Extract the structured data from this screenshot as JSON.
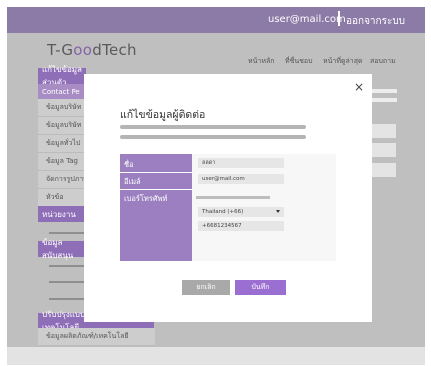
{
  "topbar": {
    "user_email": "user@mail.com",
    "logout_label": "ออกจากระบบ"
  },
  "header": {
    "brand_prefix": "T-G",
    "brand_accent": "oo",
    "brand_suffix": "dTech",
    "nav": [
      "หน้าหลัก",
      "ที่ชื่นชอบ",
      "หน้าที่ดูล่าสุด",
      "สอบถาม"
    ]
  },
  "sidebar": {
    "section1_title": "แก้ไขข้อมูลส่วนตัว",
    "section1_sub": "Contact Pe",
    "items": [
      "ข้อมูลบริษัท",
      "ข้อมูลบริษัท",
      "ข้อมูลทั่วไป",
      "ข้อมูล Tag",
      "จัดการรูปภาพ",
      "หัวข้อ"
    ],
    "section2_title": "หน่วยงาน",
    "section3_title": "ข้อมูลสนับสนุน",
    "section4_title": "ปรับปรุงแบบผลิตภัณฑ์/เทคโนโลยี",
    "section4_item": "ข้อมูลผลิตภัณฑ์/เทคโนโลยี"
  },
  "modal": {
    "close_glyph": "×",
    "title": "แก้ไขข้อมูลผู้ติดต่อ",
    "fields": {
      "name_label": "ชื่อ",
      "name_value": "ลลดา",
      "email_label": "อีเมล์",
      "email_value": "user@mail.com",
      "phone_label": "เบอร์โทรศัพท์",
      "country_value": "Thailand (+66)",
      "phone_value": "+6681234567"
    },
    "cancel_label": "ยกเลิก",
    "save_label": "บันทึก"
  },
  "colors": {
    "topbar": "#8c7aa7",
    "accent": "#8f6eb8",
    "save_button": "#9b6fd1",
    "cancel_button": "#a9a9a9"
  }
}
